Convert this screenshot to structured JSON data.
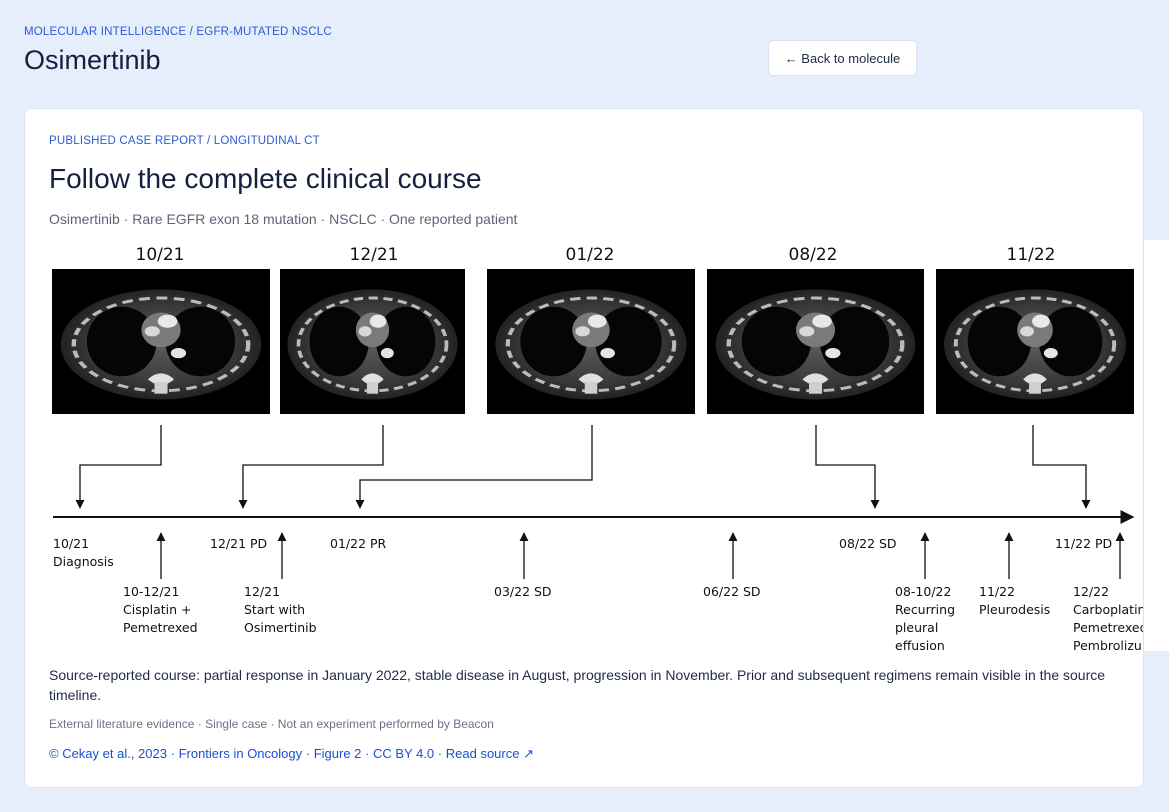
{
  "header": {
    "breadcrumb": "MOLECULAR INTELLIGENCE / EGFR-MUTATED NSCLC",
    "title": "Osimertinib",
    "back_label": "← Back to molecule"
  },
  "card": {
    "eyebrow": "PUBLISHED CASE REPORT / LONGITUDINAL CT",
    "title": "Follow the complete clinical course",
    "subtitle": "Osimertinib · Rare EGFR exon 18 mutation · NSCLC · One reported patient",
    "summary": "Source-reported course: partial response in January 2022, stable disease in August, progression in November. Prior and subsequent regimens remain visible in the source timeline.",
    "note": "External literature evidence · Single case · Not an experiment performed by Beacon",
    "citation": {
      "author": "© Cekay et al., 2023",
      "journal": "Frontiers in Oncology",
      "figure": "Figure 2",
      "license": "CC BY 4.0",
      "link": "Read source ↗"
    }
  },
  "figure": {
    "scans": [
      "10/21",
      "12/21",
      "01/22",
      "08/22",
      "11/22"
    ],
    "upper_labels": {
      "diagnosis": [
        "10/21",
        "Diagnosis"
      ],
      "pd1": "12/21 PD",
      "pr": "01/22 PR",
      "sd": "08/22 SD",
      "pd2": "11/22 PD"
    },
    "lower_labels": {
      "chemo": [
        "10-12/21",
        "Cisplatin   +",
        "Pemetrexed"
      ],
      "osi": [
        "12/21",
        "Start      with",
        "Osimertinib"
      ],
      "sd_mar": "03/22 SD",
      "sd_jun": "06/22 SD",
      "effusion": [
        "08-10/22",
        "Recurring",
        "pleural",
        "effusion"
      ],
      "pleurodesis": [
        "11/22",
        "Pleurodesis"
      ],
      "carbo": [
        "12/22",
        "Carboplatin +",
        "Pemetrexed +",
        "Pembrolizumab"
      ]
    }
  }
}
